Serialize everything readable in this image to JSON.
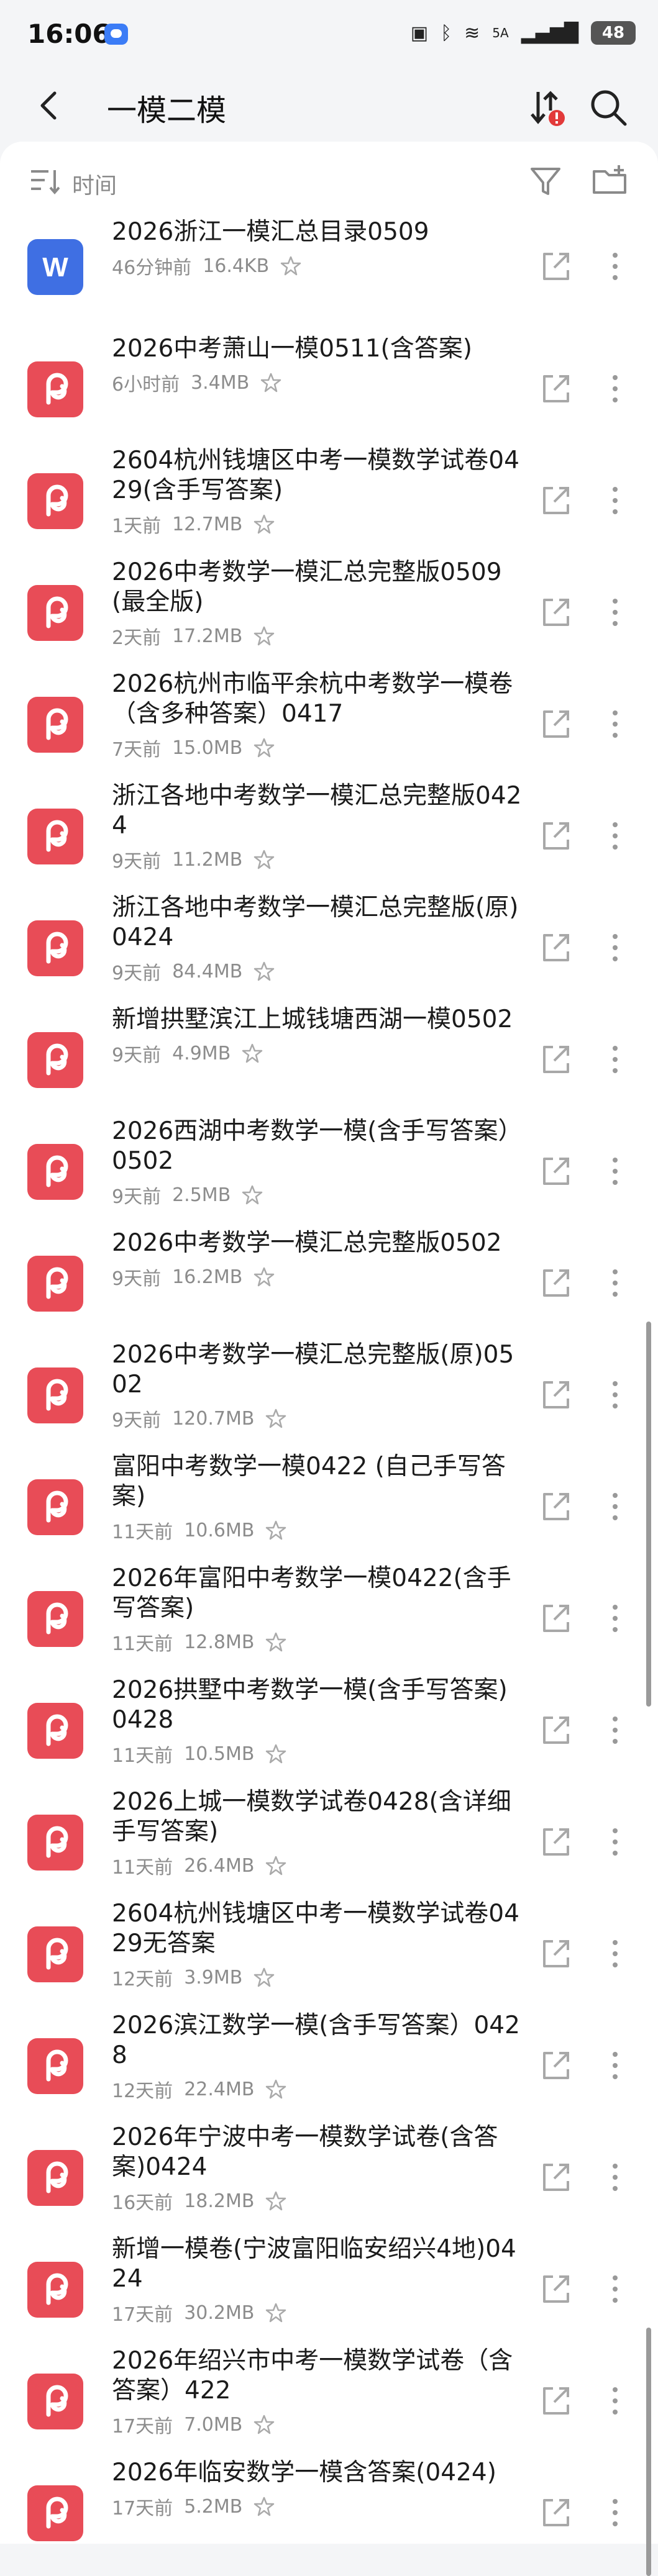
{
  "status": {
    "time": "16:06",
    "network": "5A",
    "battery": "48"
  },
  "header": {
    "title": "一模二模"
  },
  "toolbar": {
    "sort_label": "时间"
  },
  "files": [
    {
      "type": "word",
      "name": "2026浙江一模汇总目录0509",
      "time": "46分钟前",
      "size": "16.4KB"
    },
    {
      "type": "pdf",
      "name": "2026中考萧山一模0511(含答案)",
      "time": "6小时前",
      "size": "3.4MB"
    },
    {
      "type": "pdf",
      "name": "2604杭州钱塘区中考一模数学试卷0429(含手写答案)",
      "time": "1天前",
      "size": "12.7MB"
    },
    {
      "type": "pdf",
      "name": "2026中考数学一模汇总完整版0509(最全版)",
      "time": "2天前",
      "size": "17.2MB"
    },
    {
      "type": "pdf",
      "name": "2026杭州市临平余杭中考数学一模卷（含多种答案）0417",
      "time": "7天前",
      "size": "15.0MB"
    },
    {
      "type": "pdf",
      "name": "浙江各地中考数学一模汇总完整版0424",
      "time": "9天前",
      "size": "11.2MB"
    },
    {
      "type": "pdf",
      "name": "浙江各地中考数学一模汇总完整版(原)0424",
      "time": "9天前",
      "size": "84.4MB"
    },
    {
      "type": "pdf",
      "name": "新增拱墅滨江上城钱塘西湖一模0502",
      "time": "9天前",
      "size": "4.9MB"
    },
    {
      "type": "pdf",
      "name": "2026西湖中考数学一模(含手写答案）0502",
      "time": "9天前",
      "size": "2.5MB"
    },
    {
      "type": "pdf",
      "name": "2026中考数学一模汇总完整版0502",
      "time": "9天前",
      "size": "16.2MB"
    },
    {
      "type": "pdf",
      "name": "2026中考数学一模汇总完整版(原)0502",
      "time": "9天前",
      "size": "120.7MB"
    },
    {
      "type": "pdf",
      "name": "富阳中考数学一模0422 (自己手写答案)",
      "time": "11天前",
      "size": "10.6MB"
    },
    {
      "type": "pdf",
      "name": "2026年富阳中考数学一模0422(含手写答案)",
      "time": "11天前",
      "size": "12.8MB"
    },
    {
      "type": "pdf",
      "name": "2026拱墅中考数学一模(含手写答案)0428",
      "time": "11天前",
      "size": "10.5MB"
    },
    {
      "type": "pdf",
      "name": "2026上城一模数学试卷0428(含详细手写答案)",
      "time": "11天前",
      "size": "26.4MB"
    },
    {
      "type": "pdf",
      "name": "2604杭州钱塘区中考一模数学试卷0429无答案",
      "time": "12天前",
      "size": "3.9MB"
    },
    {
      "type": "pdf",
      "name": "2026滨江数学一模(含手写答案）0428",
      "time": "12天前",
      "size": "22.4MB"
    },
    {
      "type": "pdf",
      "name": "2026年宁波中考一模数学试卷(含答案)0424",
      "time": "16天前",
      "size": "18.2MB"
    },
    {
      "type": "pdf",
      "name": "新增一模卷(宁波富阳临安绍兴4地)0424",
      "time": "17天前",
      "size": "30.2MB"
    },
    {
      "type": "pdf",
      "name": "2026年绍兴市中考一模数学试卷（含答案）422",
      "time": "17天前",
      "size": "7.0MB"
    },
    {
      "type": "pdf",
      "name": "2026年临安数学一模含答案(0424)",
      "time": "17天前",
      "size": "5.2MB"
    }
  ]
}
